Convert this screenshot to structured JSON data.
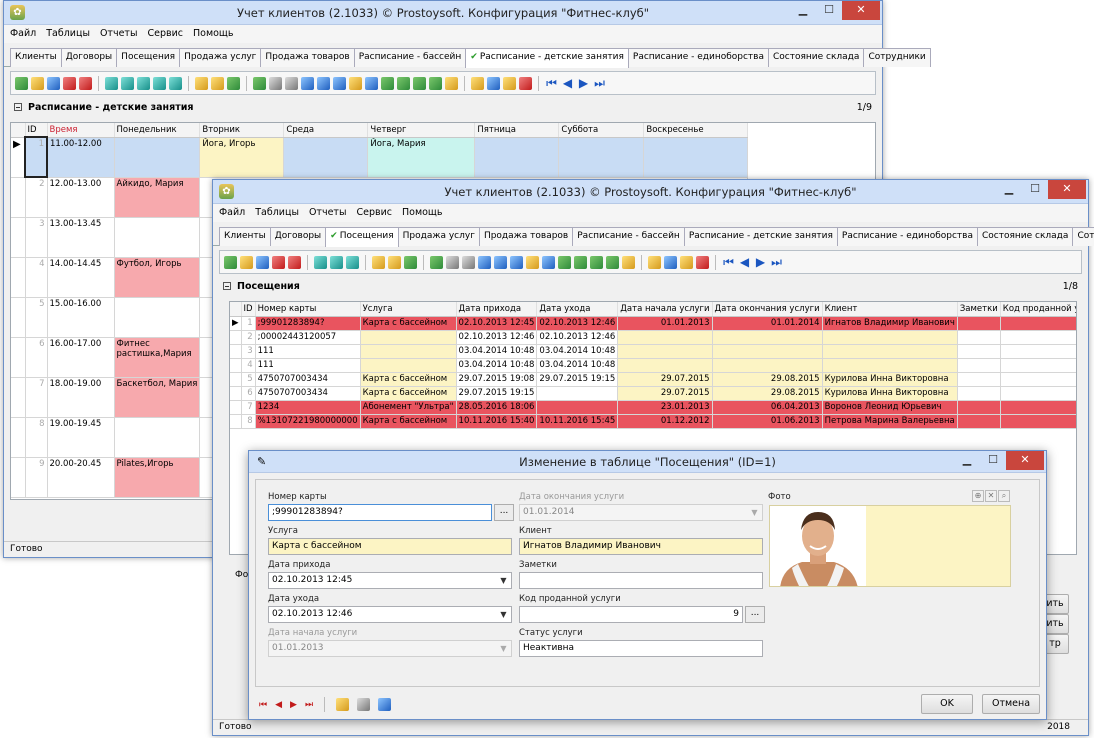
{
  "back": {
    "title": "Учет клиентов (2.1033) © Prostoysoft. Конфигурация \"Фитнес-клуб\"",
    "menu": [
      "Файл",
      "Таблицы",
      "Отчеты",
      "Сервис",
      "Помощь"
    ],
    "tabs": [
      "Клиенты",
      "Договоры",
      "Посещения",
      "Продажа услуг",
      "Продажа товаров",
      "Расписание - бассейн",
      "Расписание - детские занятия",
      "Расписание - единоборства",
      "Состояние склада",
      "Сотрудники"
    ],
    "active_tab": 6,
    "section_title": "Расписание - детские занятия",
    "section_count": "1/9",
    "columns": [
      "ID",
      "Время",
      "Понедельник",
      "Вторник",
      "Среда",
      "Четверг",
      "Пятница",
      "Суббота",
      "Воскресенье"
    ],
    "rows": [
      {
        "id": "1",
        "time": "11.00-12.00",
        "mon": "",
        "tue": "Йога, Игорь",
        "wed": "",
        "thu": "Йога, Мария",
        "fri": "",
        "sat": "",
        "sun": ""
      },
      {
        "id": "2",
        "time": "12.00-13.00",
        "mon": "Айкидо, Мария"
      },
      {
        "id": "3",
        "time": "13.00-13.45",
        "mon": ""
      },
      {
        "id": "4",
        "time": "14.00-14.45",
        "mon": "Футбол, Игорь"
      },
      {
        "id": "5",
        "time": "15.00-16.00",
        "mon": ""
      },
      {
        "id": "6",
        "time": "16.00-17.00",
        "mon": "Фитнес растишка,Мария"
      },
      {
        "id": "7",
        "time": "18.00-19.00",
        "mon": "Баскетбол, Мария"
      },
      {
        "id": "8",
        "time": "19.00-19.45",
        "mon": ""
      },
      {
        "id": "9",
        "time": "20.00-20.45",
        "mon": "Pilates,Игорь"
      }
    ],
    "status": "Готово"
  },
  "front": {
    "title": "Учет клиентов (2.1033) © Prostoysoft. Конфигурация \"Фитнес-клуб\"",
    "menu": [
      "Файл",
      "Таблицы",
      "Отчеты",
      "Сервис",
      "Помощь"
    ],
    "tabs": [
      "Клиенты",
      "Договоры",
      "Посещения",
      "Продажа услуг",
      "Продажа товаров",
      "Расписание - бассейн",
      "Расписание - детские занятия",
      "Расписание - единоборства",
      "Состояние склада",
      "Сотрудники"
    ],
    "active_tab": 2,
    "section_title": "Посещения",
    "section_count": "1/8",
    "columns": [
      "ID",
      "Номер карты",
      "Услуга",
      "Дата прихода",
      "Дата ухода",
      "Дата начала услуги",
      "Дата окончания услуги",
      "Клиент",
      "Заметки",
      "Код проданной услуги"
    ],
    "rows": [
      {
        "id": "1",
        "card": ";99901283894?",
        "service": "Карта с бассейном",
        "in": "02.10.2013 12:45",
        "out": "02.10.2013 12:46",
        "start": "01.01.2013",
        "end": "01.01.2014",
        "client": "Игнатов Владимир Иванович",
        "notes": "",
        "code": "9",
        "style": "dred"
      },
      {
        "id": "2",
        "card": ";00002443120057",
        "service": "",
        "in": "02.10.2013 12:46",
        "out": "02.10.2013 12:46",
        "start": "",
        "end": "",
        "client": "",
        "notes": "",
        "code": "",
        "style": "plain"
      },
      {
        "id": "3",
        "card": "111",
        "service": "",
        "in": "03.04.2014 10:48",
        "out": "03.04.2014 10:48",
        "start": "",
        "end": "",
        "client": "",
        "notes": "",
        "code": "",
        "style": "plain"
      },
      {
        "id": "4",
        "card": "111",
        "service": "",
        "in": "03.04.2014 10:48",
        "out": "03.04.2014 10:48",
        "start": "",
        "end": "",
        "client": "",
        "notes": "",
        "code": "",
        "style": "plain"
      },
      {
        "id": "5",
        "card": "4750707003434",
        "service": "Карта с бассейном",
        "in": "29.07.2015 19:08",
        "out": "29.07.2015 19:15",
        "start": "29.07.2015",
        "end": "29.08.2015",
        "client": "Курилова Инна Викторовна",
        "notes": "",
        "code": "22",
        "style": "plain"
      },
      {
        "id": "6",
        "card": "4750707003434",
        "service": "Карта с бассейном",
        "in": "29.07.2015 19:15",
        "out": "",
        "start": "29.07.2015",
        "end": "29.08.2015",
        "client": "Курилова Инна Викторовна",
        "notes": "",
        "code": "22",
        "style": "plain"
      },
      {
        "id": "7",
        "card": "1234",
        "service": "Абонемент \"Ультра\"",
        "in": "28.05.2016 18:06",
        "out": "",
        "start": "23.01.2013",
        "end": "06.04.2013",
        "client": "Воронов Леонид Юрьевич",
        "notes": "",
        "code": "7",
        "style": "dred"
      },
      {
        "id": "8",
        "card": "%13107221980000000",
        "service": "Карта с бассейном",
        "in": "10.11.2016 15:40",
        "out": "10.11.2016 15:45",
        "start": "01.12.2012",
        "end": "01.06.2013",
        "client": "Петрова Марина Валерьевна",
        "notes": "",
        "code": "2",
        "style": "dred"
      }
    ],
    "status": "Готово",
    "year": "2018",
    "side_buttons": [
      "ить",
      "ить",
      "тр"
    ],
    "side_label": "Фо"
  },
  "dialog": {
    "title": "Изменение в таблице \"Посещения\" (ID=1)",
    "card_label": "Номер карты",
    "card_value": ";99901283894?",
    "service_label": "Услуга",
    "service_value": "Карта с бассейном",
    "in_label": "Дата прихода",
    "in_value": "02.10.2013 12:45",
    "out_label": "Дата ухода",
    "out_value": "02.10.2013 12:46",
    "start_label": "Дата начала услуги",
    "start_value": "01.01.2013",
    "end_label": "Дата окончания услуги",
    "end_value": "01.01.2014",
    "client_label": "Клиент",
    "client_value": "Игнатов Владимир Иванович",
    "notes_label": "Заметки",
    "notes_value": "",
    "code_label": "Код проданной услуги",
    "code_value": "9",
    "status_label": "Статус услуги",
    "status_value": "Неактивна",
    "photo_label": "Фото",
    "ellipsis": "...",
    "ok": "OK",
    "cancel": "Отмена"
  }
}
